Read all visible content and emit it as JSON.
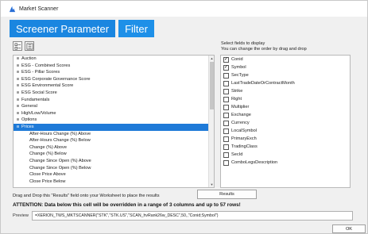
{
  "window": {
    "title": "Market Scanner"
  },
  "tabs": [
    {
      "label": "Screener Parameter",
      "active": true
    },
    {
      "label": "Filter",
      "active": false
    }
  ],
  "toolbar": {
    "icons": [
      "expand-all-icon",
      "collapse-all-icon"
    ]
  },
  "tree": {
    "items": [
      {
        "label": "Auction",
        "expander": "⊞",
        "child": false,
        "selected": false
      },
      {
        "label": "ESG - Combined Scores",
        "expander": "⊞",
        "child": false,
        "selected": false
      },
      {
        "label": "ESG - Pillar Scores",
        "expander": "⊞",
        "child": false,
        "selected": false
      },
      {
        "label": "ESG Corporate Governance Score",
        "expander": "⊞",
        "child": false,
        "selected": false
      },
      {
        "label": "ESG Environmental Score",
        "expander": "⊞",
        "child": false,
        "selected": false
      },
      {
        "label": "ESG Social Score",
        "expander": "⊞",
        "child": false,
        "selected": false
      },
      {
        "label": "Fundamentals",
        "expander": "⊞",
        "child": false,
        "selected": false
      },
      {
        "label": "General",
        "expander": "⊞",
        "child": false,
        "selected": false
      },
      {
        "label": "High/Low/Volume",
        "expander": "⊞",
        "child": false,
        "selected": false
      },
      {
        "label": "Options",
        "expander": "⊞",
        "child": false,
        "selected": false
      },
      {
        "label": "Prices",
        "expander": "⊟",
        "child": false,
        "selected": true
      },
      {
        "label": "After-Hours Change (%) Above",
        "expander": "",
        "child": true,
        "selected": false
      },
      {
        "label": "After-Hours Change (%) Below",
        "expander": "",
        "child": true,
        "selected": false
      },
      {
        "label": "Change (%) Above",
        "expander": "",
        "child": true,
        "selected": false
      },
      {
        "label": "Change (%) Below",
        "expander": "",
        "child": true,
        "selected": false
      },
      {
        "label": "Change Since Open (%) Above",
        "expander": "",
        "child": true,
        "selected": false
      },
      {
        "label": "Change Since Open (%) Below",
        "expander": "",
        "child": true,
        "selected": false
      },
      {
        "label": "Close Price Above",
        "expander": "",
        "child": true,
        "selected": false
      },
      {
        "label": "Close Price Below",
        "expander": "",
        "child": true,
        "selected": false
      }
    ]
  },
  "fields_panel": {
    "hint_line1": "Select fields to display",
    "hint_line2": "You can change the order by drag and drop",
    "items": [
      {
        "label": "Conid",
        "checked": true
      },
      {
        "label": "Symbol",
        "checked": true
      },
      {
        "label": "SecType",
        "checked": false
      },
      {
        "label": "LastTradeDateOrContractMonth",
        "checked": false
      },
      {
        "label": "Strike",
        "checked": false
      },
      {
        "label": "Right",
        "checked": false
      },
      {
        "label": "Multiplier",
        "checked": false
      },
      {
        "label": "Exchange",
        "checked": false
      },
      {
        "label": "Currency",
        "checked": false
      },
      {
        "label": "LocalSymbol",
        "checked": false
      },
      {
        "label": "PrimaryExch",
        "checked": false
      },
      {
        "label": "TradingClass",
        "checked": false
      },
      {
        "label": "SecId",
        "checked": false
      },
      {
        "label": "ComboLegsDescription",
        "checked": false
      }
    ]
  },
  "drag_text": "Drag and Drop this \"Results\" field onto your Worksheet to place the results",
  "results_button": "Results",
  "attention": "ATTENTION: Data below this cell will be overridden in a range of 3 columns and up to 57 rows!",
  "preview": {
    "label": "Preview",
    "value": "=XERION_TWS_MKTSCANNER(\"STK\",\"STK.US\",\"SCAN_hvRank26w_DESC\",50,,\"Conid;Symbol\")"
  },
  "ok_button": "OK",
  "colors": {
    "tab_blue": "#1e90e8",
    "selection_blue": "#1e7ad8"
  }
}
